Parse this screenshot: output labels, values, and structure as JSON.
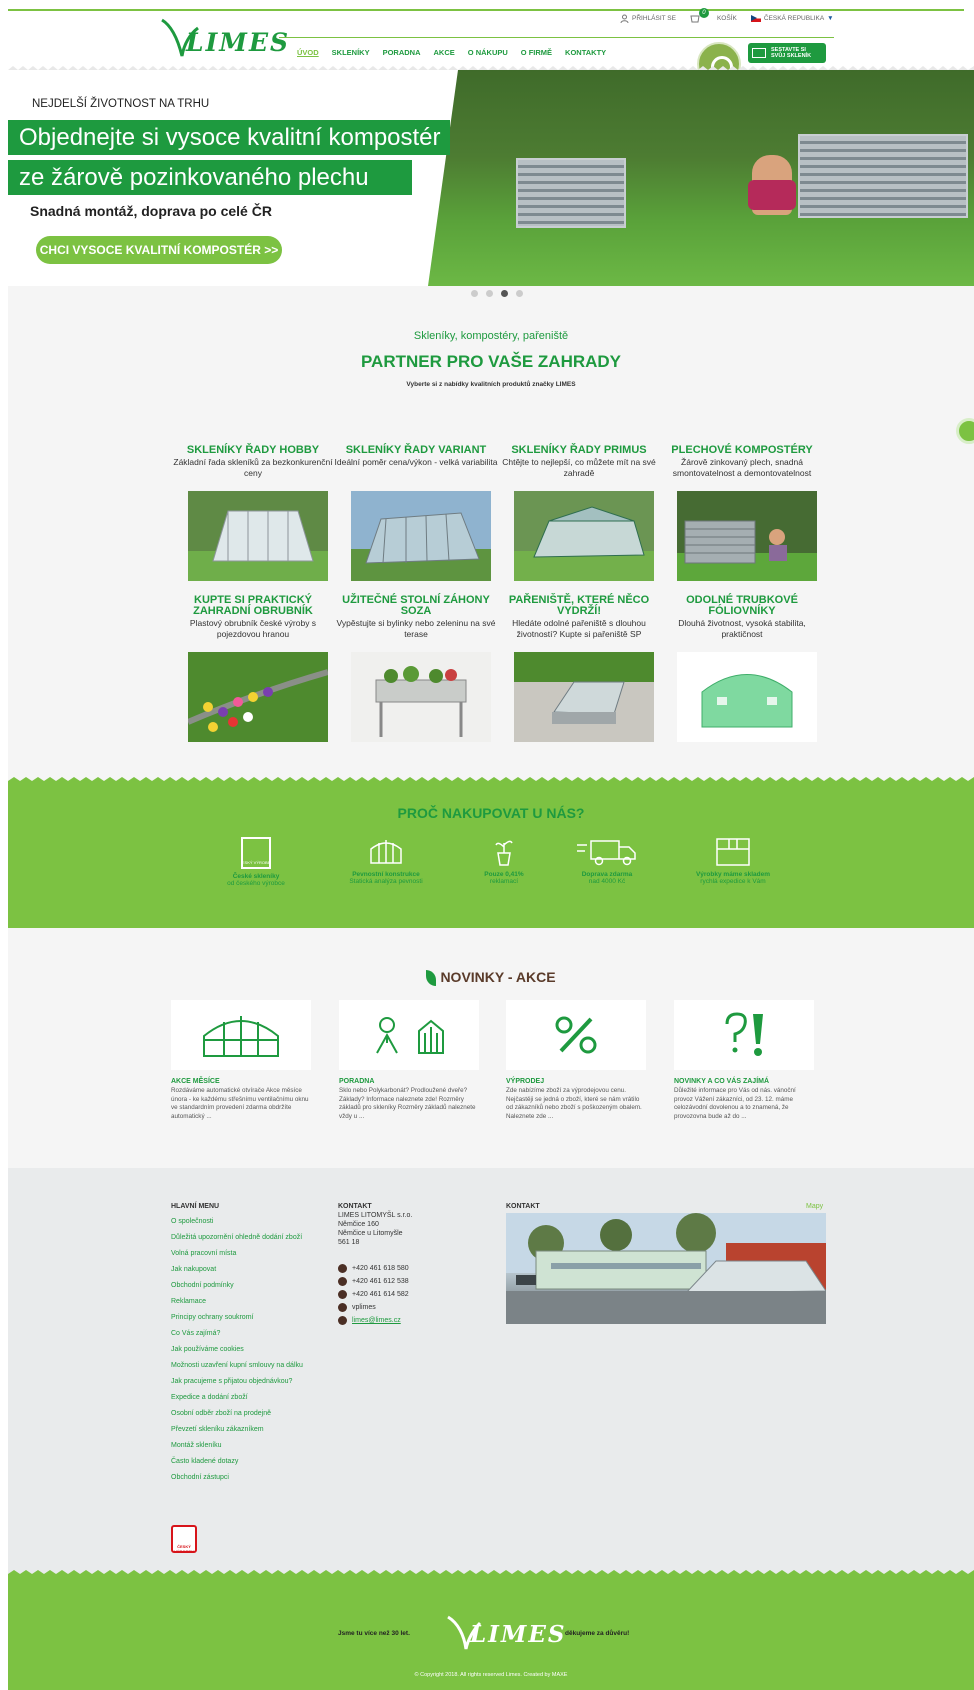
{
  "header": {
    "login": "PŘIHLÁSIT SE",
    "cart_label": "KOŠÍK",
    "cart_count": "0",
    "country": "ČESKÁ REPUBLIKA",
    "logo": "LIMES",
    "nav": [
      "ÚVOD",
      "SKLENÍKY",
      "PORADNA",
      "AKCE",
      "O NÁKUPU",
      "O FIRMĚ",
      "KONTAKTY"
    ],
    "configure_btn": "SESTAVTE SI SVŮJ SKLENÍK"
  },
  "hero": {
    "tagline": "NEJDELŠÍ ŽIVOTNOST NA TRHU",
    "headline_1": "Objednejte si vysoce kvalitní kompostér",
    "headline_2": "ze žárově pozinkovaného plechu",
    "subline": "Snadná montáž, doprava po celé ČR",
    "cta": "CHCI VYSOCE KVALITNÍ KOMPOSTÉR >>",
    "slides_total": 4,
    "slide_active": 3
  },
  "partner": {
    "subtitle": "Skleníky, kompostéry, pařeniště",
    "title": "PARTNER PRO VAŠE ZAHRADY",
    "desc": "Vyberte si z nabídky kvalitních produktů značky LIMES",
    "products": [
      {
        "title": "SKLENÍKY ŘADY HOBBY",
        "desc": "Základní řada skleníků za bezkonkurenční ceny"
      },
      {
        "title": "SKLENÍKY ŘADY VARIANT",
        "desc": "Ideální poměr cena/výkon - velká variabilita"
      },
      {
        "title": "SKLENÍKY ŘADY PRIMUS",
        "desc": "Chtějte to nejlepší, co můžete mít na své zahradě"
      },
      {
        "title": "PLECHOVÉ KOMPOSTÉRY",
        "desc": "Žárově zinkovaný plech, snadná smontovatelnost a demontovatelnost"
      },
      {
        "title": "KUPTE SI PRAKTICKÝ ZAHRADNÍ OBRUBNÍK",
        "desc": "Plastový obrubník české výroby s pojezdovou hranou"
      },
      {
        "title": "UŽITEČNÉ STOLNÍ ZÁHONY SOZA",
        "desc": "Vypěstujte si bylinky nebo zeleninu na své terase"
      },
      {
        "title": "PAŘENIŠTĚ, KTERÉ NĚCO VYDRŽÍ!",
        "desc": "Hledáte odolné pařeniště s dlouhou životností? Kupte si pařeniště SP"
      },
      {
        "title": "ODOLNÉ TRUBKOVÉ FÓLIOVNÍKY",
        "desc": "Dlouhá životnost, vysoká stabilita, praktičnost"
      }
    ]
  },
  "why": {
    "title": "PROČ NAKUPOVAT U NÁS?",
    "items": [
      {
        "title": "České skleníky",
        "desc": "od českého výrobce"
      },
      {
        "title": "Pevnostní konstrukce",
        "desc": "Statická analýza pevnosti"
      },
      {
        "title": "Pouze 0,41%",
        "desc": "reklamací"
      },
      {
        "title": "Doprava zdarma",
        "desc": "nad 4000 Kč"
      },
      {
        "title": "Výrobky máme skladem",
        "desc": "rychlá expedice k Vám"
      }
    ]
  },
  "news": {
    "title": "NOVINKY - AKCE",
    "items": [
      {
        "title": "AKCE MĚSÍCE",
        "text": "Rozdáváme automatické otvírače Akce měsíce února - ke každému střešnímu ventilačnímu oknu ve standardním provedení zdarma obdržíte automatický ..."
      },
      {
        "title": "PORADNA",
        "text": "Sklo nebo Polykarbonát? Prodloužené dveře? Základy? Informace naleznete zde! Rozměry základů pro skleníky Rozměry základů naleznete vždy u ..."
      },
      {
        "title": "VÝPRODEJ",
        "text": "Zde nabízíme zboží za výprodejovou cenu. Nejčastěji se jedná o zboží, které se nám vrátilo od zákazníků nebo zboží s poškozeným obalem. Naleznete zde ..."
      },
      {
        "title": "NOVINKY A CO VÁS ZAJÍMÁ",
        "text": "Důležité informace pro Vás od nás. vánoční provoz Vážení zákazníci, od 23. 12. máme celozávodní dovolenou a to znamená, že provozovna bude až do ..."
      }
    ]
  },
  "footer": {
    "menu_title": "HLAVNÍ MENU",
    "menu": [
      "O společnosti",
      "Důležitá upozornění ohledně dodání zboží",
      "Volná pracovní místa",
      "Jak nakupovat",
      "Obchodní podmínky",
      "Reklamace",
      "Principy ochrany soukromí",
      "Co Vás zajímá?",
      "Jak používáme cookies",
      "Možnosti uzavření kupní smlouvy na dálku",
      "Jak pracujeme s přijatou objednávkou?",
      "Expedice a dodání zboží",
      "Osobní odběr zboží na prodejně",
      "Převzetí skleníku zákazníkem",
      "Montáž skleníku",
      "Často kladené dotazy",
      "Obchodní zástupci"
    ],
    "contact_title": "KONTAKT",
    "contact_lines": [
      "LIMES LITOMYŠL s.r.o.",
      "Němčice 160",
      "Němčice u Litomyšle",
      "561 18"
    ],
    "phones": [
      "+420 461 618 580",
      "+420 461 612 538",
      "+420 461 614 582"
    ],
    "skype": "vplimes",
    "email": "limes@limes.cz",
    "map_title": "KONTAKT",
    "map_link": "Mapy",
    "cz_badge": "ČESKÝ VÝROBEK",
    "bottom_left": "Jsme tu více než 30 let.",
    "bottom_logo": "LIMES",
    "bottom_right": "děkujeme za důvěru!",
    "copyright": "© Copyright 2018. All rights reserved Limes. Created by MAXE"
  },
  "colors": {
    "brand_green": "#1e9a3f",
    "light_green": "#7cc242",
    "dark_brown": "#4b2f25"
  }
}
